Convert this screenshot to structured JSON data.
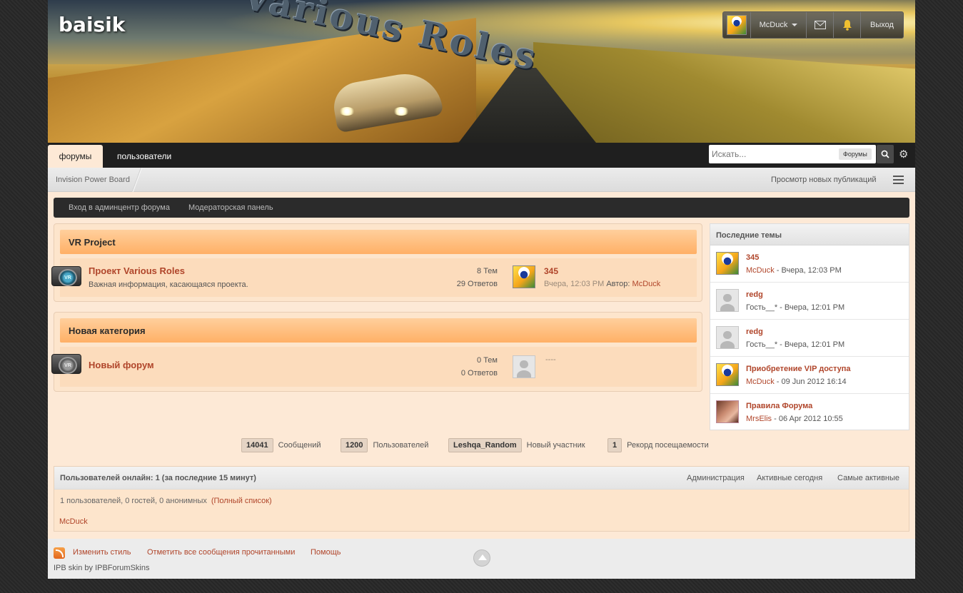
{
  "header": {
    "site_name": "baisik",
    "banner_logo": "Various Roles"
  },
  "userbar": {
    "username": "McDuck",
    "mail_icon": "envelope-icon",
    "bell_icon": "bell-icon",
    "logout": "Выход"
  },
  "nav": {
    "tabs": [
      {
        "label": "форумы",
        "active": true
      },
      {
        "label": "пользователи",
        "active": false
      }
    ],
    "search_placeholder": "Искать...",
    "search_scope": "Форумы"
  },
  "breadcrumb": {
    "root": "Invision Power Board",
    "new_posts": "Просмотр новых публикаций"
  },
  "adminbar": {
    "acp": "Вход в админцентр форума",
    "modcp": "Модераторская панель"
  },
  "categories": [
    {
      "title": "VR Project",
      "forums": [
        {
          "title": "Проект Various Roles",
          "description": "Важная информация, касающаяся проекта.",
          "topics": "8 Тем",
          "replies": "29 Ответов",
          "last_title": "345",
          "last_time": "Вчера, 12:03 PM",
          "last_author_label": "Автор:",
          "last_author": "McDuck"
        }
      ]
    },
    {
      "title": "Новая категория",
      "forums": [
        {
          "title": "Новый форум",
          "description": "",
          "topics": "0 Тем",
          "replies": "0 Ответов",
          "last_title": "----"
        }
      ]
    }
  ],
  "sidebar": {
    "title": "Последние темы",
    "items": [
      {
        "title": "345",
        "author": "McDuck",
        "meta": " - Вчера, 12:03 PM",
        "avatar": "duck"
      },
      {
        "title": "redg",
        "author": "",
        "meta": "Гость__* - Вчера, 12:01 PM",
        "avatar": "guest"
      },
      {
        "title": "redg",
        "author": "",
        "meta": "Гость__* - Вчера, 12:01 PM",
        "avatar": "guest"
      },
      {
        "title": "Приобретение VIP доступа",
        "author": "McDuck",
        "meta": " - 09 Jun 2012 16:14",
        "avatar": "duck"
      },
      {
        "title": "Правила Форума",
        "author": "MrsElis",
        "meta": " - 06 Apr 2012 10:55",
        "avatar": "girl"
      }
    ]
  },
  "stats": {
    "posts_num": "14041",
    "posts_label": "Сообщений",
    "members_num": "1200",
    "members_label": "Пользователей",
    "newest_num": "Leshqa_Random",
    "newest_label": "Новый участник",
    "record_num": "1",
    "record_label": "Рекорд посещаемости"
  },
  "online": {
    "title": "Пользователей онлайн: 1 (за последние 15 минут)",
    "links": [
      "Администрация",
      "Активные сегодня",
      "Самые активные"
    ],
    "summary": "1 пользователей, 0 гостей, 0 анонимных",
    "full_list": "(Полный список)",
    "users": "McDuck"
  },
  "footer": {
    "change_style": "Изменить стиль",
    "mark_read": "Отметить все сообщения прочитанными",
    "help": "Помощь",
    "skin_credit": "IPB skin by IPBForumSkins"
  },
  "colors": {
    "accent": "#b0452a",
    "category_header": "#ffb066",
    "page_bg": "#fde9d6",
    "nav_bg": "#1f1f1f"
  }
}
